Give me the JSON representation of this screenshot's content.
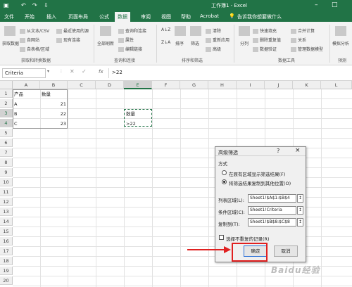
{
  "titlebar": {
    "title": "工作簿1 - Excel",
    "undo_icon": "undo-icon",
    "redo_icon": "redo-icon",
    "save_icon": "save-icon",
    "autosave_icon": "autosave-icon"
  },
  "tabs": [
    {
      "label": "文件"
    },
    {
      "label": "开始"
    },
    {
      "label": "插入"
    },
    {
      "label": "页面布局"
    },
    {
      "label": "公式"
    },
    {
      "label": "数据"
    },
    {
      "label": "审阅"
    },
    {
      "label": "视图"
    },
    {
      "label": "帮助"
    },
    {
      "label": "Acrobat"
    }
  ],
  "tellme": "告诉我你想要做什么",
  "ribbon": {
    "get_data_label": "获取数据",
    "from_csv": "从文本/CSV",
    "from_web": "自网站",
    "from_table": "自表格/区域",
    "recent_sources": "最近使用的源",
    "existing_conn": "现有连接",
    "group_get": "获取和转换数据",
    "refresh_all": "全部刷新",
    "queries_conn": "查询和连接",
    "properties": "属性",
    "edit_links": "编辑链接",
    "group_query": "查询和连接",
    "sort": "排序",
    "filter": "筛选",
    "clear": "清除",
    "reapply": "重新应用",
    "advanced": "高级",
    "group_sort": "排序和筛选",
    "text_to_col": "分列",
    "flash_fill": "快速填充",
    "remove_dup": "删除重复值",
    "data_valid": "数据验证",
    "consolidate": "合并计算",
    "relationships": "关系",
    "manage_model": "管理数据模型",
    "group_tools": "数据工具",
    "what_if": "模拟分析",
    "group_forecast": "预测"
  },
  "formula_bar": {
    "name_box": "Criteria",
    "fx": "fx",
    "value": ">22"
  },
  "sheet": {
    "columns": [
      "A",
      "B",
      "C",
      "D",
      "E",
      "F",
      "G",
      "H",
      "I",
      "J",
      "K",
      "L"
    ],
    "rows": [
      "1",
      "2",
      "3",
      "4",
      "5",
      "6",
      "7",
      "8",
      "9",
      "10",
      "11",
      "12",
      "13",
      "14",
      "15",
      "16",
      "17",
      "18",
      "19",
      "20"
    ],
    "cells": {
      "a1": "产品",
      "b1": "数量",
      "a2": "A",
      "b2": "21",
      "a3": "B",
      "b3": "22",
      "a4": "C",
      "b4": "23",
      "e3": "数量",
      "e4": ">22"
    }
  },
  "dialog": {
    "title": "高级筛选",
    "help": "?",
    "close": "×",
    "method_label": "方式",
    "option1": "在原有区域显示筛选结果(F)",
    "option2": "将筛选结果复制到其他位置(O)",
    "list_range_label": "列表区域(L):",
    "list_range": "Sheet1!$A$1:$B$4",
    "criteria_label": "条件区域(C):",
    "criteria_range": "Sheet1!Criteria",
    "copy_to_label": "复制到(T):",
    "copy_to": "Sheet1!$B$8:$C$8",
    "unique_label": "选择不重复的记录(R)",
    "ok": "确定",
    "cancel": "取消"
  },
  "watermark": "Baidu经验",
  "colors": {
    "excel_green": "#217346",
    "highlight_red": "#e02020"
  }
}
